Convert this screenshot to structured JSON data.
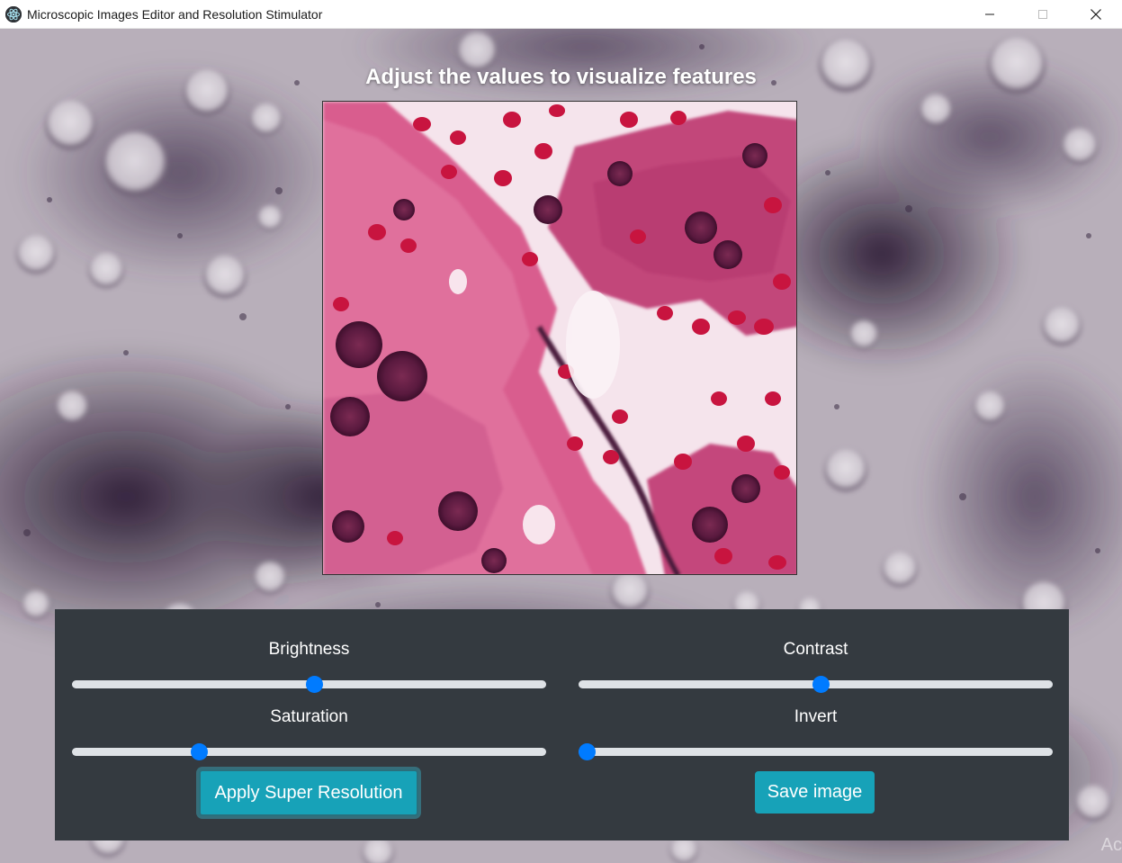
{
  "window": {
    "title": "Microscopic Images Editor and Resolution Stimulator",
    "icon": "electron-atom-icon",
    "controls": [
      "minimize-icon",
      "maximize-icon",
      "close-icon"
    ]
  },
  "heading": "Adjust the values to visualize features",
  "controls": {
    "brightness": {
      "label": "Brightness",
      "value": 0.51
    },
    "contrast": {
      "label": "Contrast",
      "value": 0.51
    },
    "saturation": {
      "label": "Saturation",
      "value": 0.26
    },
    "invert": {
      "label": "Invert",
      "value": 0.0
    }
  },
  "buttons": {
    "apply": "Apply Super Resolution",
    "save": "Save image"
  },
  "colors": {
    "panel": "#343a40",
    "track": "#dee2e6",
    "thumb": "#007bff",
    "button": "#17a2b8"
  },
  "watermark": "Ac"
}
